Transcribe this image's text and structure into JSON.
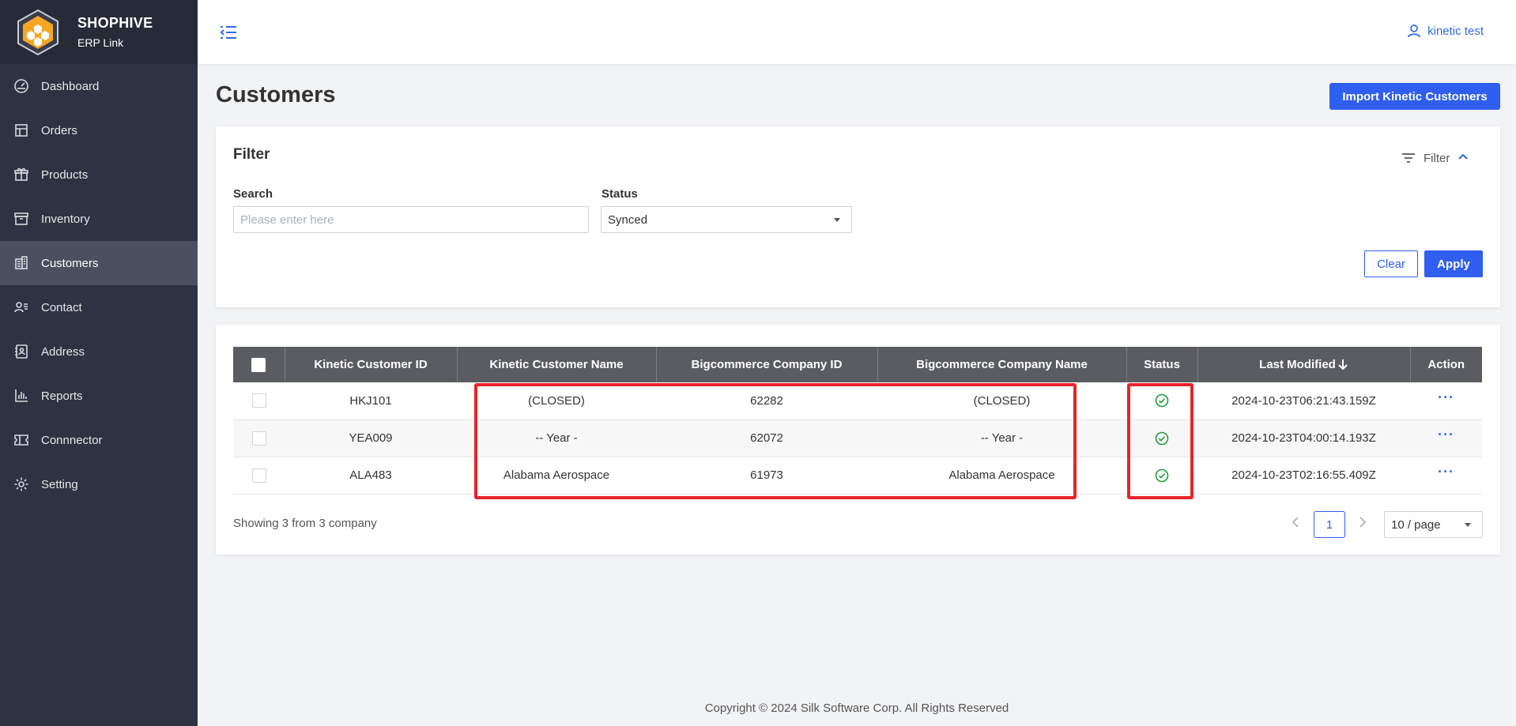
{
  "brand": {
    "name": "SHOPHIVE",
    "subtitle": "ERP Link"
  },
  "sidebar": {
    "items": [
      {
        "label": "Dashboard",
        "icon": "dashboard-icon"
      },
      {
        "label": "Orders",
        "icon": "orders-icon"
      },
      {
        "label": "Products",
        "icon": "gift-icon"
      },
      {
        "label": "Inventory",
        "icon": "archive-box-icon"
      },
      {
        "label": "Customers",
        "icon": "building-icon",
        "active": true
      },
      {
        "label": "Contact",
        "icon": "contact-card-icon"
      },
      {
        "label": "Address",
        "icon": "address-book-icon"
      },
      {
        "label": "Reports",
        "icon": "bar-chart-icon"
      },
      {
        "label": "Connnector",
        "icon": "ticket-icon"
      },
      {
        "label": "Setting",
        "icon": "gear-icon"
      }
    ]
  },
  "header": {
    "user": "kinetic test"
  },
  "page": {
    "title": "Customers",
    "import_label": "Import Kinetic Customers"
  },
  "filter": {
    "title": "Filter",
    "toggle_label": "Filter",
    "search_label": "Search",
    "search_placeholder": "Please enter here",
    "status_label": "Status",
    "status_value": "Synced",
    "clear_label": "Clear",
    "apply_label": "Apply"
  },
  "table": {
    "columns": [
      "Kinetic Customer ID",
      "Kinetic Customer Name",
      "Bigcommerce Company ID",
      "Bigcommerce Company Name",
      "Status",
      "Last Modified",
      "Action"
    ],
    "rows": [
      {
        "id": "HKJ101",
        "name": "(CLOSED)",
        "bc_id": "62282",
        "bc_name": "(CLOSED)",
        "status": "synced",
        "modified": "2024-10-23T06:21:43.159Z",
        "action": "···"
      },
      {
        "id": "YEA009",
        "name": "-- Year -",
        "bc_id": "62072",
        "bc_name": "-- Year -",
        "status": "synced",
        "modified": "2024-10-23T04:00:14.193Z",
        "action": "···"
      },
      {
        "id": "ALA483",
        "name": "Alabama Aerospace",
        "bc_id": "61973",
        "bc_name": "Alabama Aerospace",
        "status": "synced",
        "modified": "2024-10-23T02:16:55.409Z",
        "action": "···"
      }
    ]
  },
  "pagination": {
    "showing": "Showing 3 from 3 company",
    "current_page": "1",
    "page_size": "10 / page"
  },
  "footer": {
    "copyright": "Copyright © 2024 Silk Software Corp. All Rights Reserved"
  },
  "colors": {
    "sidebar": "#2f3242",
    "accent": "#2f5ef0",
    "highlight": "#e8232b",
    "status_ok": "#1e9e3a"
  }
}
